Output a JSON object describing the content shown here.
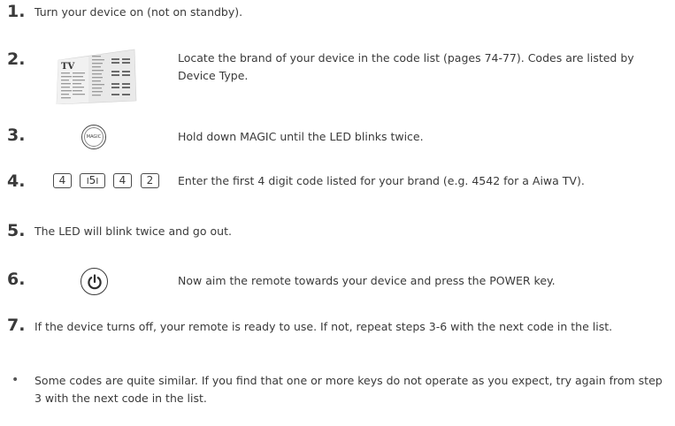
{
  "steps": [
    {
      "num": "1.",
      "text": "Turn your device on (not on standby)."
    },
    {
      "num": "2.",
      "text": "Locate the brand of your device in the code list (pages 74-77). Codes are listed by Device Type."
    },
    {
      "num": "3.",
      "text": "Hold down MAGIC until the LED blinks twice."
    },
    {
      "num": "4.",
      "text": "Enter the first 4 digit code listed for your brand (e.g. 4542 for a Aiwa TV)."
    },
    {
      "num": "5.",
      "text": "The LED will blink twice and go out."
    },
    {
      "num": "6.",
      "text": "Now aim the remote towards your device and press the POWER key."
    },
    {
      "num": "7.",
      "text": "If the device turns off, your remote is ready to use. If not, repeat steps 3-6 with the next code in the list."
    }
  ],
  "note": {
    "bullet": "•",
    "text": "Some codes are quite similar. If you find that one or more keys do not operate as you expect, try again from step 3 with the next code in the list."
  },
  "illustrations": {
    "code_list_thumb_label": "TV",
    "magic_button_label": "MAGIC",
    "digit_keys": [
      "4",
      "5",
      "4",
      "2"
    ],
    "power_icon": "power-icon"
  }
}
